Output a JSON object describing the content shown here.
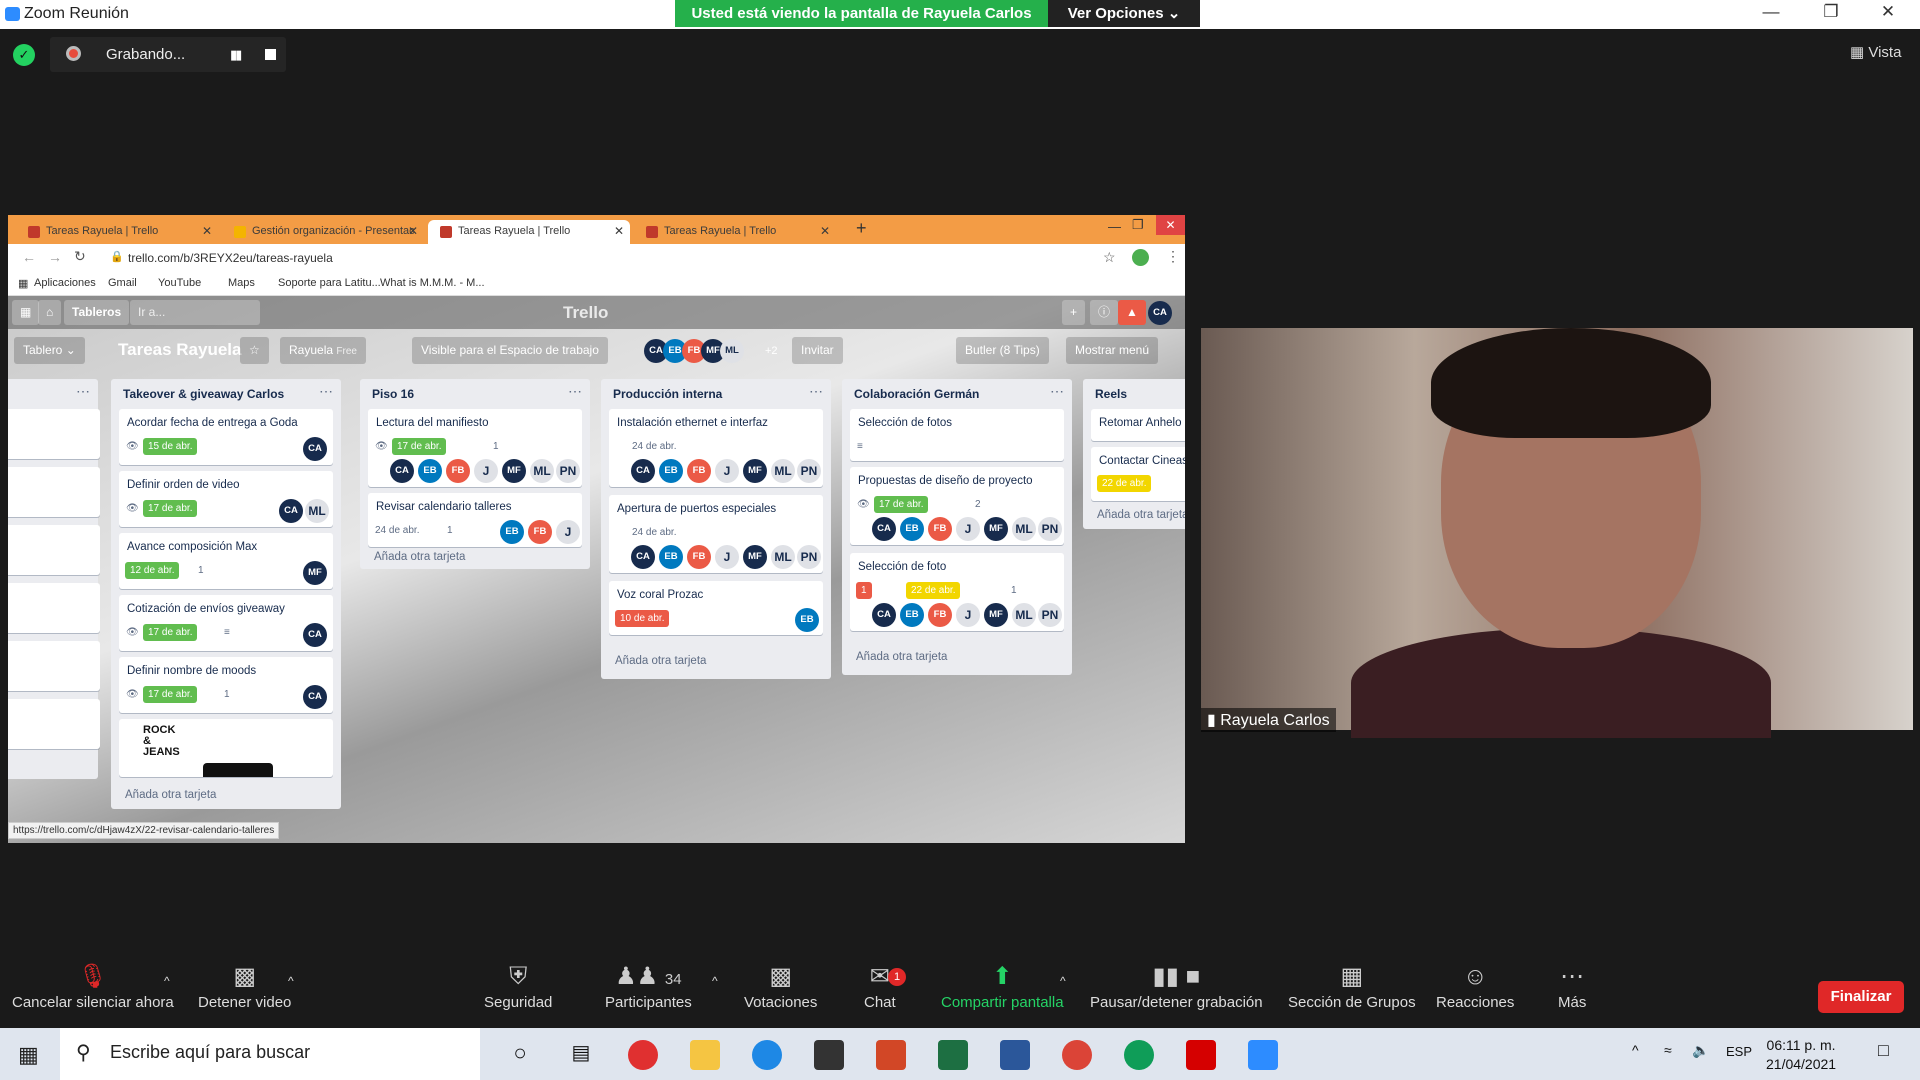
{
  "window": {
    "app_title": "Zoom Reunión",
    "share_banner": "Usted está viendo la pantalla de Rayuela Carlos",
    "view_options": "Ver Opciones ⌄"
  },
  "recording": {
    "label": "Grabando..."
  },
  "view_button": "Vista",
  "browser": {
    "tabs": [
      {
        "label": "Tareas Rayuela | Trello"
      },
      {
        "label": "Gestión organización - Presentac"
      },
      {
        "label": "Tareas Rayuela | Trello"
      },
      {
        "label": "Tareas Rayuela | Trello"
      }
    ],
    "url": "trello.com/b/3REYX2eu/tareas-rayuela",
    "bookmarks": [
      "Aplicaciones",
      "Gmail",
      "YouTube",
      "Maps",
      "Soporte para Latitu...",
      "What is M.M.M. - M..."
    ],
    "status_url": "https://trello.com/c/dHjaw4zX/22-revisar-calendario-talleres"
  },
  "trello": {
    "logo": "Trello",
    "boards_btn": "Tableros",
    "search_placeholder": "Ir a...",
    "avatar": "CA",
    "board_menu": "Tablero ⌄",
    "board_title": "Tareas Rayuela",
    "workspace": "Rayuela",
    "free_badge": "Free",
    "visibility": "Visible para el Espacio de trabajo",
    "extra_members": "+2",
    "invite": "Invitar",
    "butler": "Butler (8 Tips)",
    "show_menu": "Mostrar menú",
    "add_card": "Añada otra tarjeta",
    "lists": [
      {
        "title": "Takeover & giveaway Carlos",
        "cards": [
          {
            "title": "Acordar fecha de entrega a Goda",
            "date": "15 de abr."
          },
          {
            "title": "Definir orden de video",
            "date": "17 de abr."
          },
          {
            "title": "Avance composición Max",
            "date": "12 de abr.",
            "attachments": "1"
          },
          {
            "title": "Cotización de envíos giveaway",
            "date": "17 de abr."
          },
          {
            "title": "Definir nombre de moods",
            "date": "17 de abr.",
            "attachments": "1"
          }
        ],
        "image_card_text": "ROCK & JEANS"
      },
      {
        "title": "Piso 16",
        "cards": [
          {
            "title": "Lectura del manifiesto",
            "date": "17 de abr.",
            "attachments": "1"
          },
          {
            "title": "Revisar calendario talleres",
            "date": "24 de abr.",
            "attachments": "1"
          }
        ]
      },
      {
        "title": "Producción interna",
        "cards": [
          {
            "title": "Instalación ethernet e interfaz",
            "date": "24 de abr."
          },
          {
            "title": "Apertura de puertos especiales",
            "date": "24 de abr."
          },
          {
            "title": "Voz coral Prozac",
            "date": "10 de abr."
          }
        ]
      },
      {
        "title": "Colaboración Germán",
        "cards": [
          {
            "title": "Selección de fotos"
          },
          {
            "title": "Propuestas de diseño de proyecto",
            "date": "17 de abr.",
            "checklist": "2"
          },
          {
            "title": "Selección de foto",
            "alerts": "1",
            "date": "22 de abr.",
            "comments": "1"
          }
        ]
      },
      {
        "title": "Reels",
        "cards": [
          {
            "title": "Retomar Anhelo"
          },
          {
            "title": "Contactar Cineasta",
            "date": "22 de abr."
          }
        ]
      }
    ]
  },
  "video": {
    "participant_name": "Rayuela Carlos"
  },
  "toolbar": {
    "unmute": "Cancelar silenciar ahora",
    "stop_video": "Detener video",
    "security": "Seguridad",
    "participants": "Participantes",
    "participants_count": "34",
    "polls": "Votaciones",
    "chat": "Chat",
    "chat_badge": "1",
    "share": "Compartir pantalla",
    "pause_rec": "Pausar/detener grabación",
    "breakout": "Sección de Grupos",
    "reactions": "Reacciones",
    "more": "Más",
    "end": "Finalizar"
  },
  "taskbar": {
    "search_placeholder": "Escribe aquí para buscar",
    "lang": "ESP",
    "time": "06:11 p. m.",
    "date": "21/04/2021"
  },
  "colors": {
    "zoom_green": "#25b04b",
    "trello_green": "#61bd4f",
    "trello_red": "#eb5a46",
    "trello_yellow": "#f2d600",
    "tab_orange": "#f39c45",
    "end_red": "#e02828"
  }
}
